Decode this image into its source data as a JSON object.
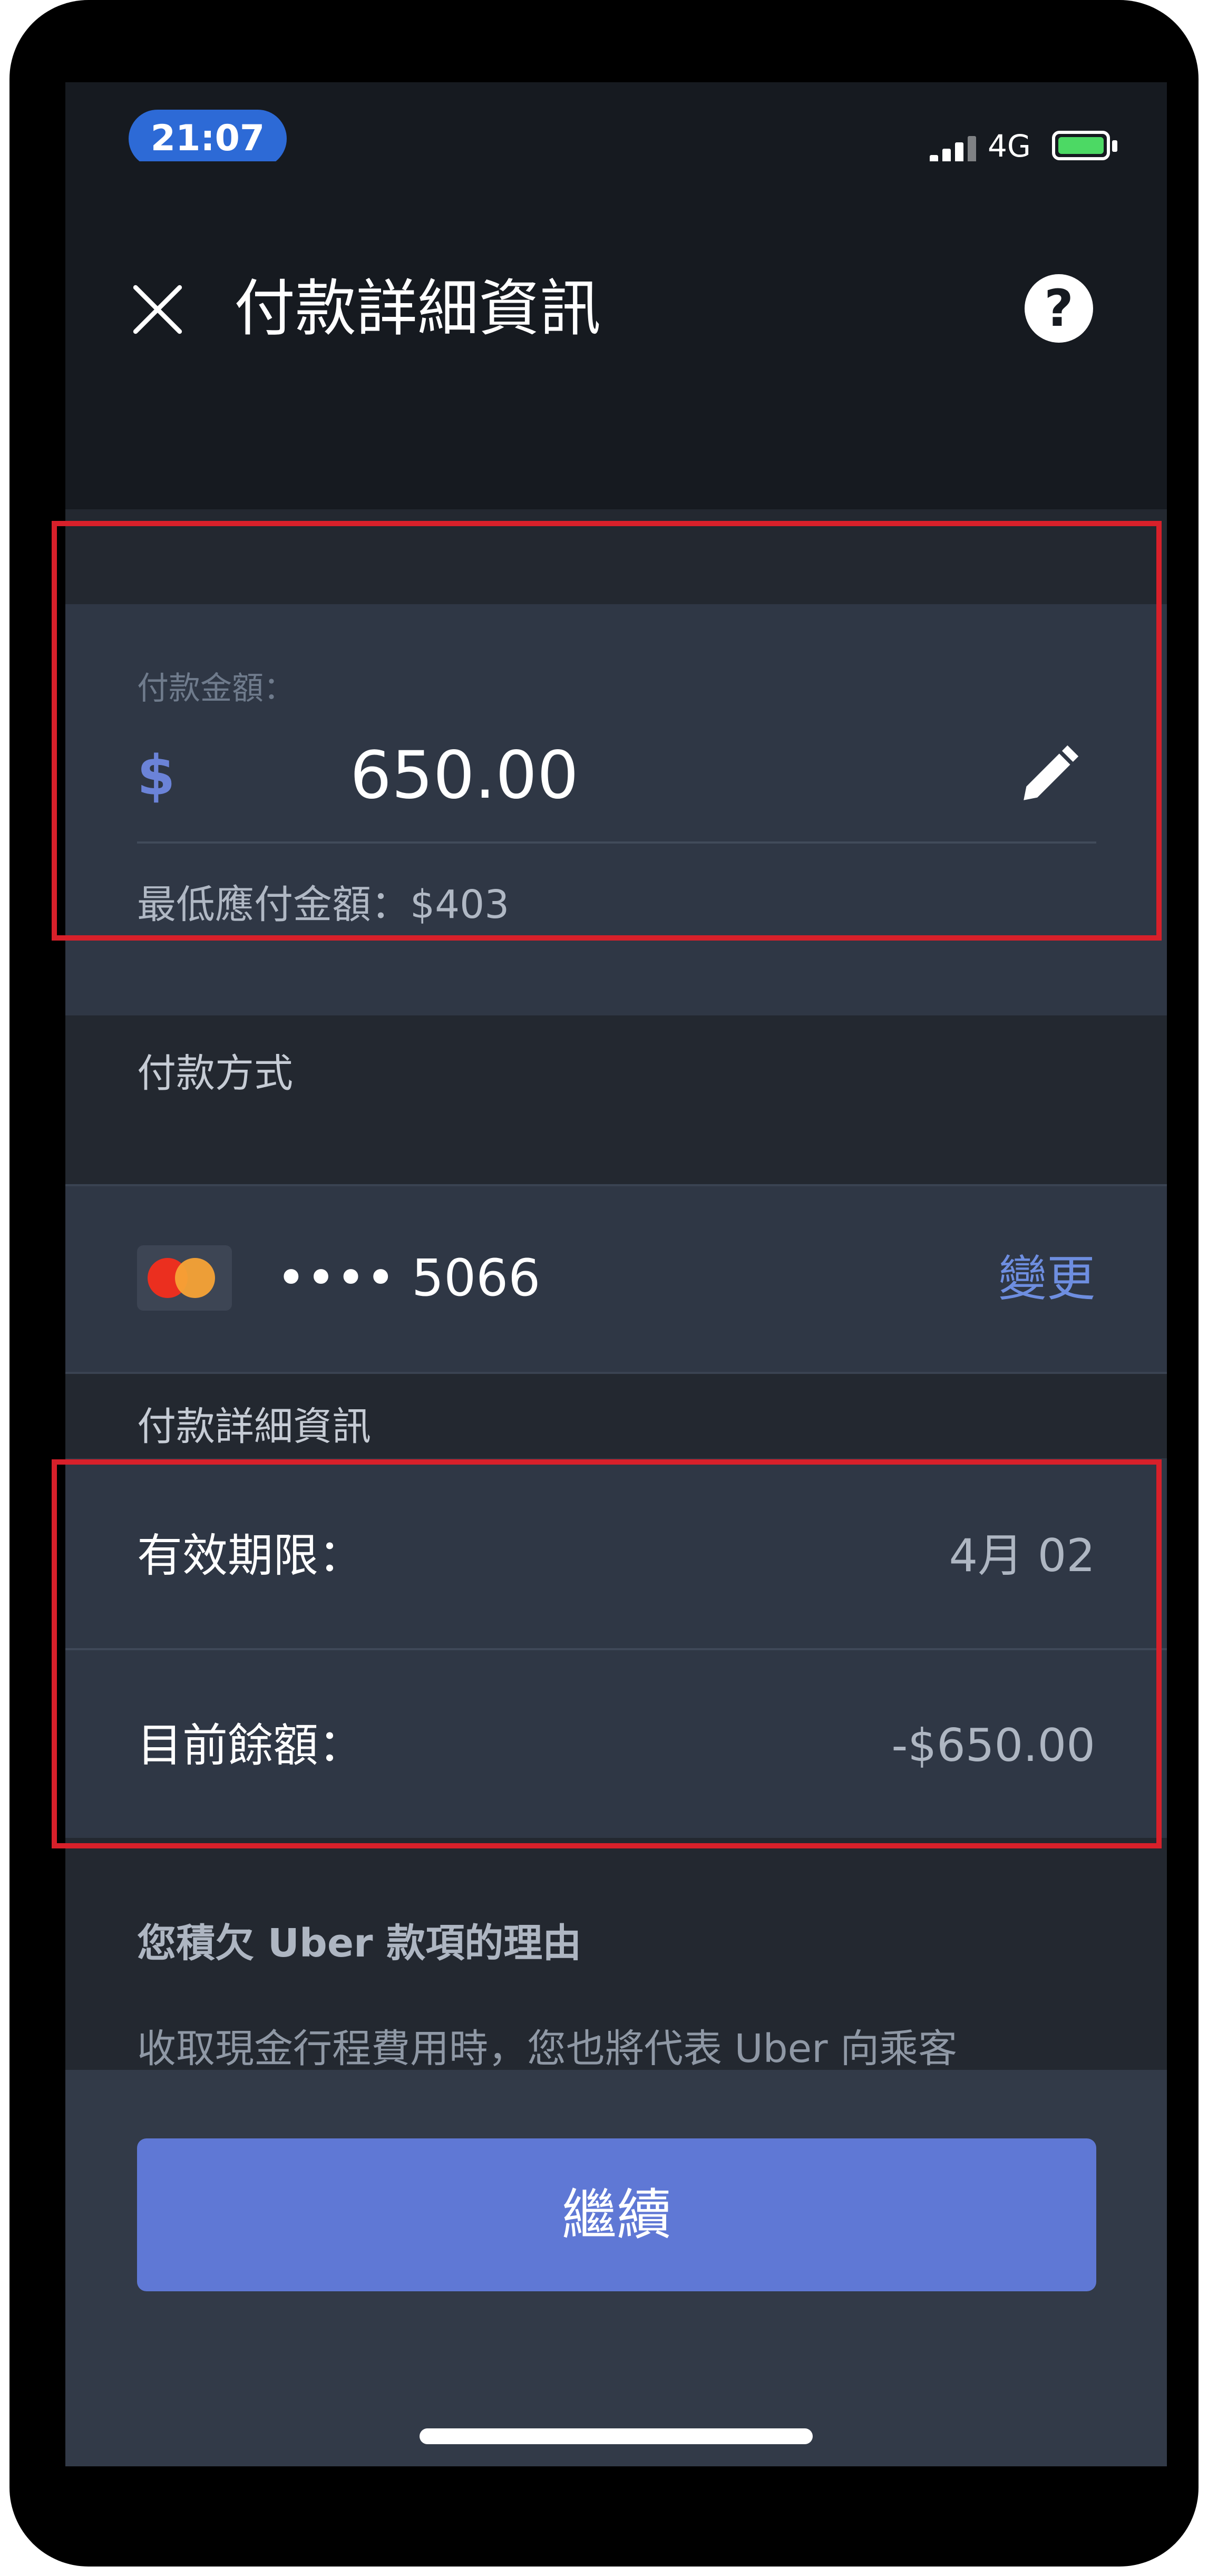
{
  "status_bar": {
    "time": "21:07",
    "network": "4G",
    "colors": {
      "time_pill": "#2d6ad6",
      "battery_fill": "#4cd964"
    }
  },
  "header": {
    "title": "付款詳細資訊",
    "close_icon": "close-icon",
    "help_icon": "help-icon",
    "help_glyph": "?"
  },
  "amount": {
    "label": "付款金額：",
    "currency_symbol": "$",
    "value": "650.00",
    "minimum_text": "最低應付金額：$403",
    "edit_icon": "pencil-icon"
  },
  "payment_method": {
    "section_title": "付款方式",
    "card_icon": "mastercard-icon",
    "card_number": "•••• 5066",
    "change_label": "變更"
  },
  "details": {
    "section_title": "付款詳細資訊",
    "rows": [
      {
        "label": "有效期限：",
        "value": "4月 02"
      },
      {
        "label": "目前餘額：",
        "value": "-$650.00"
      }
    ]
  },
  "reason": {
    "title": "您積欠 Uber 款項的理由",
    "text": "收取現金行程費用時，您也將代表 Uber 向乘客"
  },
  "footer": {
    "continue_label": "繼續"
  },
  "colors": {
    "accent": "#5f78d5",
    "link": "#6e8ee0",
    "highlight": "#d8202a",
    "background": "#232830",
    "card": "#2f3745"
  }
}
